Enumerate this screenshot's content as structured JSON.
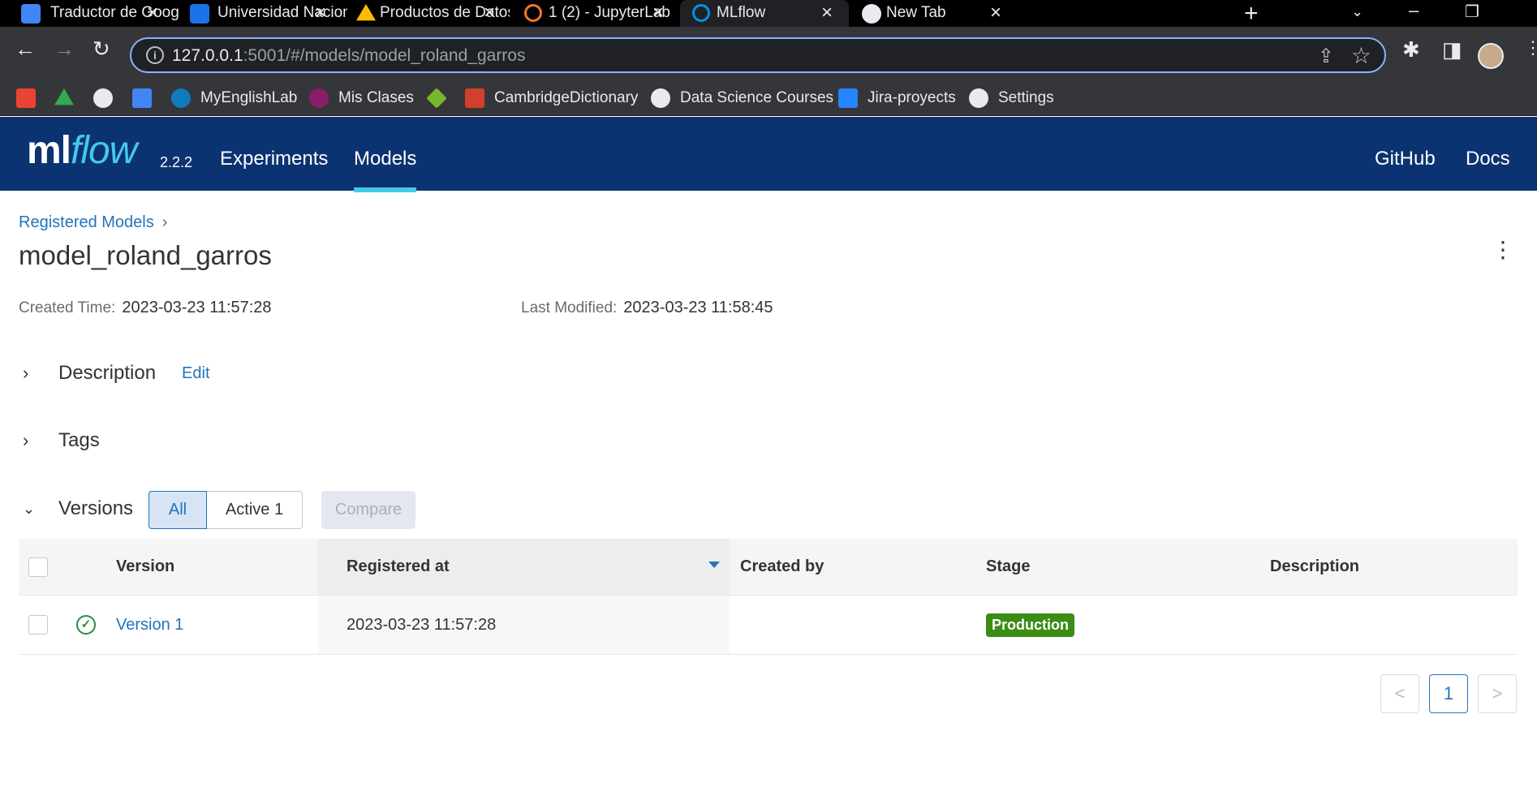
{
  "browser": {
    "tabs": [
      {
        "title": "Traductor de Google",
        "icon": "google-translate-icon",
        "color": "#4285f4"
      },
      {
        "title": "Universidad Nacional",
        "icon": "calendar-icon",
        "color": "#1a73e8"
      },
      {
        "title": "Productos de Datos",
        "icon": "google-drive-icon",
        "color": "#fbbc04"
      },
      {
        "title": "1 (2) - JupyterLab",
        "icon": "jupyter-icon",
        "color": "#f37626"
      },
      {
        "title": "MLflow",
        "icon": "mlflow-icon",
        "color": "#0194e2"
      },
      {
        "title": "New Tab",
        "icon": "chrome-icon",
        "color": "#e8eaed"
      }
    ],
    "url_host": "127.0.0.1",
    "url_rest": ":5001/#/models/model_roland_garros",
    "bookmarks": [
      {
        "label": "",
        "icon": "gmail-icon",
        "color": "#ea4335"
      },
      {
        "label": "",
        "icon": "google-drive-icon",
        "color": "#34a853"
      },
      {
        "label": "",
        "icon": "github-icon",
        "color": "#e8eaed"
      },
      {
        "label": "",
        "icon": "google-translate-icon",
        "color": "#4285f4"
      },
      {
        "label": "MyEnglishLab",
        "icon": "pearson-icon",
        "color": "#0e7bbf"
      },
      {
        "label": "Mis Clases",
        "icon": "classes-icon",
        "color": "#8b1c6b"
      },
      {
        "label": "",
        "icon": "diamond-icon",
        "color": "#76b82a"
      },
      {
        "label": "CambridgeDictionary",
        "icon": "cambridge-icon",
        "color": "#d0402c"
      },
      {
        "label": "Data Science Courses",
        "icon": "globe-icon",
        "color": "#e8eaed"
      },
      {
        "label": "Jira-proyects",
        "icon": "jira-icon",
        "color": "#2684ff"
      },
      {
        "label": "Settings",
        "icon": "gear-icon",
        "color": "#e8eaed"
      }
    ]
  },
  "header": {
    "logo_ml": "ml",
    "logo_flow": "flow",
    "version": "2.2.2",
    "nav": [
      "Experiments",
      "Models"
    ],
    "active_nav": "Models",
    "right_links": [
      "GitHub",
      "Docs"
    ],
    "accent_color": "#43c9ed",
    "background_color": "#0c3371"
  },
  "page": {
    "breadcrumb": "Registered Models",
    "title": "model_roland_garros",
    "created_label": "Created Time:",
    "created_value": "2023-03-23 11:57:28",
    "modified_label": "Last Modified:",
    "modified_value": "2023-03-23 11:58:45",
    "description_label": "Description",
    "edit_label": "Edit",
    "tags_label": "Tags",
    "versions_label": "Versions",
    "filter_all": "All",
    "filter_active": "Active 1",
    "compare_label": "Compare"
  },
  "table": {
    "columns": [
      "Version",
      "Registered at",
      "Created by",
      "Stage",
      "Description"
    ],
    "sorted_column": "Registered at",
    "rows": [
      {
        "version": "Version 1",
        "registered_at": "2023-03-23 11:57:28",
        "created_by": "",
        "stage": "Production",
        "description": "",
        "status": "ready"
      }
    ]
  },
  "pagination": {
    "prev": "<",
    "current_page": "1",
    "next": ">"
  }
}
